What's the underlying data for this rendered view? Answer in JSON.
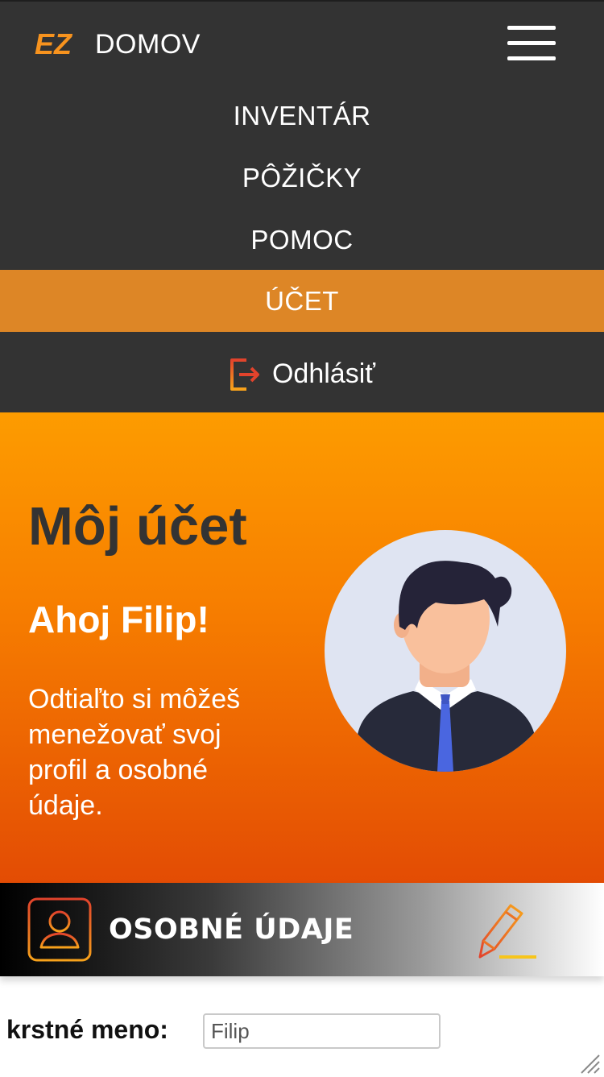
{
  "nav": {
    "brand_logo": "EZ",
    "brand_label": "DOMOV",
    "menu_icon": "hamburger-icon",
    "items": [
      {
        "label": "INVENTÁR",
        "active": false
      },
      {
        "label": "PÔŽIČKY",
        "active": false
      },
      {
        "label": "POMOC",
        "active": false
      },
      {
        "label": "ÚČET",
        "active": true
      }
    ],
    "logout_label": "Odhlásiť",
    "logout_icon": "logout-icon"
  },
  "hero": {
    "title": "Môj účet",
    "greeting": "Ahoj Filip!",
    "description": "Odtiaľto si môžeš menežovať svoj profil a osobné údaje.",
    "avatar_icon": "user-avatar-illustration"
  },
  "section": {
    "title": "OSOBNÉ ÚDAJE",
    "icon": "user-icon",
    "edit_icon": "pencil-icon"
  },
  "form": {
    "first_name_label": "krstné meno:",
    "first_name_value": "Filip"
  },
  "colors": {
    "nav_bg": "#333333",
    "active_bg": "#dd8626",
    "accent_orange": "#f7931e",
    "hero_top": "#fd9c00",
    "hero_bottom": "#e34c04",
    "title_dark": "#333333"
  }
}
